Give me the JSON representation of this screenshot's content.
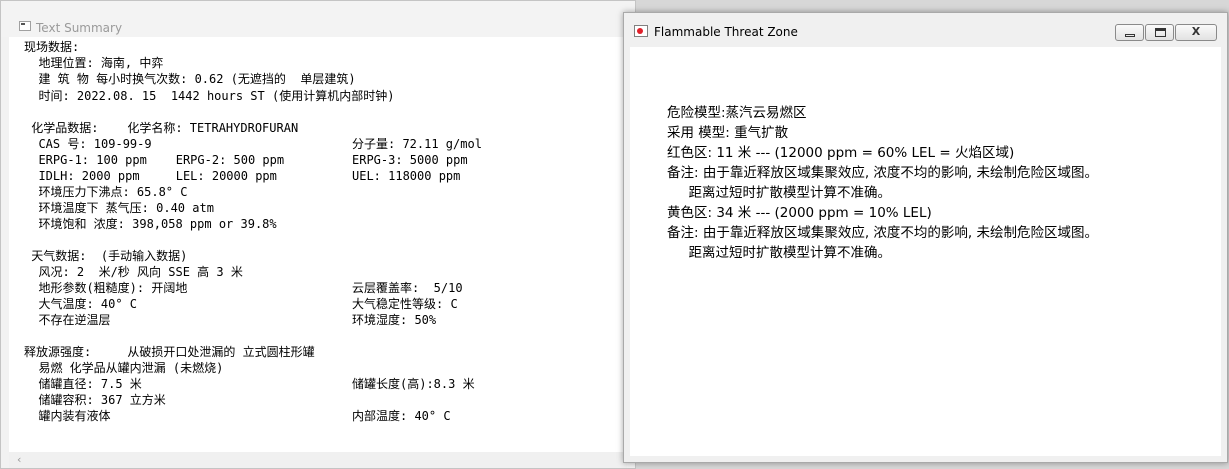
{
  "text_window": {
    "title": "Text Summary",
    "lines": [
      "现场数据:",
      "  地理位置: 海南, 中弈",
      "  建 筑 物 每小时换气次数: 0.62 (无遮挡的  单层建筑)",
      "  时间: 2022.08. 15  1442 hours ST (使用计算机内部时钟)",
      " 化学品数据:    化学名称: TETRAHYDROFURAN",
      "  CAS 号: 109-99-9",
      "分子量: 72.11 g/mol",
      "  ERPG-1: 100 ppm    ERPG-2: 500 ppm",
      "ERPG-3: 5000 ppm",
      "  IDLH: 2000 ppm     LEL: 20000 ppm",
      "UEL: 118000 ppm",
      "  环境压力下沸点: 65.8° C",
      "  环境温度下 蒸气压: 0.40 atm",
      "  环境饱和 浓度: 398,058 ppm or 39.8%",
      " 天气数据:  (手动输入数据)",
      "  风况: 2  米/秒 风向 SSE 高 3 米",
      "  地形参数(粗糙度): 开阔地",
      "云层覆盖率:  5/10",
      "  大气温度: 40° C",
      "大气稳定性等级: C",
      "  不存在逆温层",
      "环境湿度: 50%",
      "释放源强度:     从破损开口处泄漏的 立式圆柱形罐",
      "  易燃 化学品从罐内泄漏 (未燃烧)",
      "  储罐直径: 7.5 米",
      "储罐长度(高):8.3 米",
      "  储罐容积: 367 立方米",
      "  罐内装有液体",
      "内部温度: 40° C"
    ],
    "scroll_arrow": "‹"
  },
  "threat_window": {
    "title": "Flammable Threat Zone",
    "buttons": {
      "close": "X"
    },
    "lines": [
      "危险模型:蒸汽云易燃区",
      "采用 模型: 重气扩散",
      "红色区: 11 米 --- (12000 ppm = 60% LEL = 火焰区域)",
      "备注: 由于靠近释放区域集聚效应, 浓度不均的影响, 未绘制危险区域图。",
      "     距离过短时扩散模型计算不准确。",
      "黄色区: 34 米 --- (2000 ppm = 10% LEL)",
      "备注: 由于靠近释放区域集聚效应, 浓度不均的影响, 未绘制危险区域图。",
      "     距离过短时扩散模型计算不准确。"
    ]
  },
  "icons": [
    "app-window-icon",
    "threat-zone-icon",
    "minimize-icon",
    "maximize-icon",
    "close-icon",
    "scroll-left-icon"
  ],
  "colors": {
    "threat_icon_red": "#e0202a",
    "background": "#d7d7d7"
  }
}
